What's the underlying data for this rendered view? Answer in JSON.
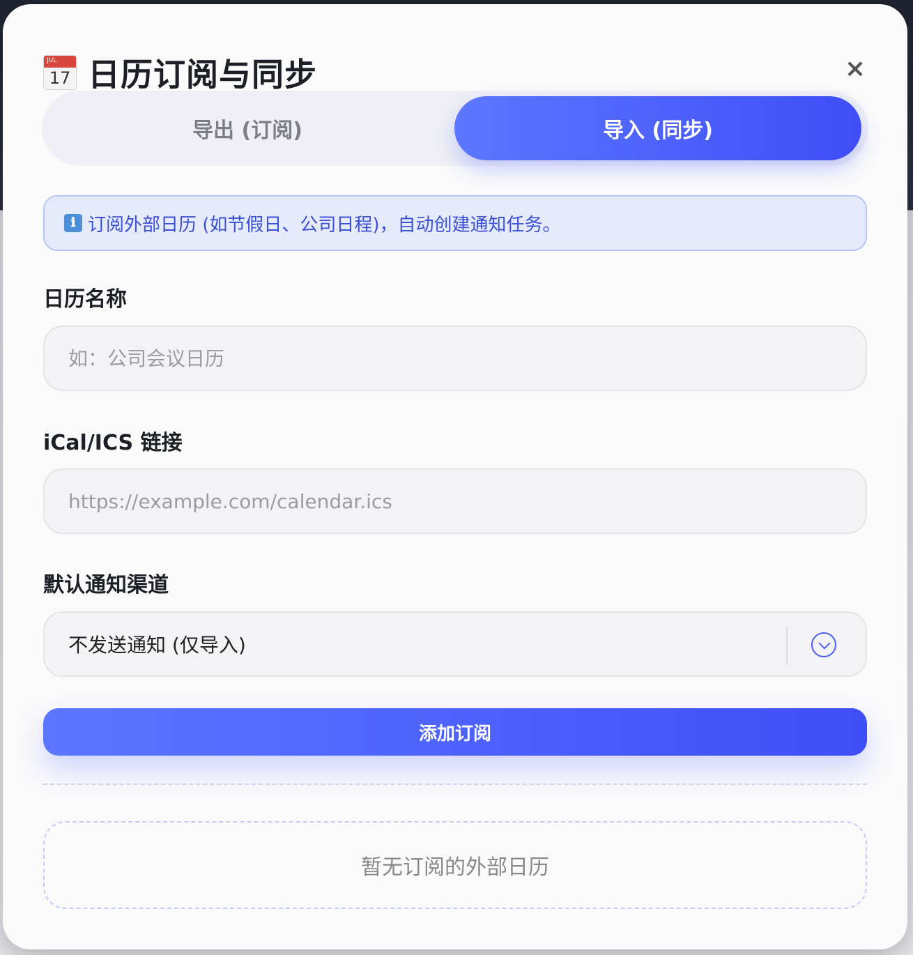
{
  "dialog": {
    "title": "日历订阅与同步",
    "icon": {
      "name": "calendar-icon",
      "month": "JUL",
      "day": "17"
    },
    "close_label": "×"
  },
  "tabs": [
    {
      "label": "导出 (订阅)",
      "active": false
    },
    {
      "label": "导入 (同步)",
      "active": true
    }
  ],
  "info": {
    "icon": "ℹ",
    "text": "订阅外部日历 (如节假日、公司日程)，自动创建通知任务。"
  },
  "form": {
    "calendar_name": {
      "label": "日历名称",
      "placeholder": "如：公司会议日历",
      "value": ""
    },
    "ics_link": {
      "label": "iCal/ICS 链接",
      "placeholder": "https://example.com/calendar.ics",
      "value": ""
    },
    "channel": {
      "label": "默认通知渠道",
      "selected": "不发送通知 (仅导入)"
    }
  },
  "actions": {
    "add_label": "添加订阅"
  },
  "empty_state": {
    "text": "暂无订阅的外部日历"
  },
  "colors": {
    "accent": "#4f5ff9",
    "info_bg": "#e6ebfb",
    "info_text": "#3a4fd6"
  }
}
